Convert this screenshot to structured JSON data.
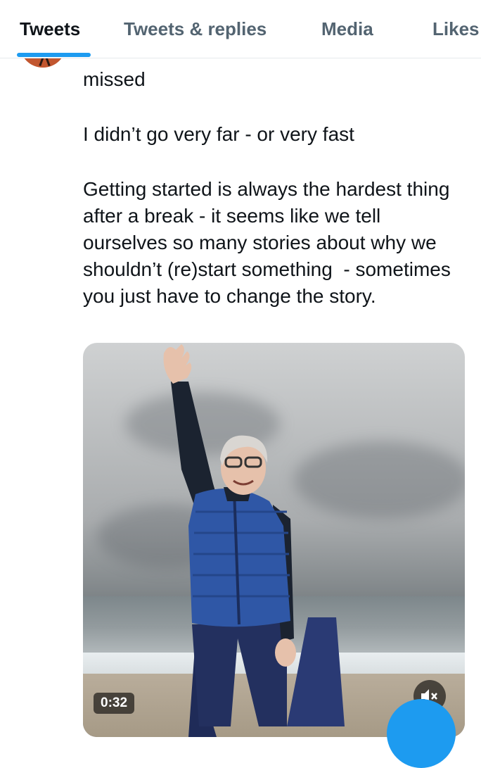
{
  "tabs": [
    {
      "label": "Tweets",
      "active": true
    },
    {
      "label": "Tweets & replies",
      "active": false
    },
    {
      "label": "Media",
      "active": false
    },
    {
      "label": "Likes",
      "active": false
    }
  ],
  "tweet": {
    "paragraphs": [
      "missed",
      "I didn’t go very far - or very fast",
      "Getting started is always the hardest thing after a break - it seems like we tell ourselves so many stories about why we shouldn’t (re)start something  - sometimes you just have to change the story."
    ],
    "video": {
      "duration": "0:32",
      "muted": true
    }
  },
  "colors": {
    "accent": "#1d9bf0",
    "text_primary": "#0f1419",
    "text_secondary": "#536471"
  },
  "icons": {
    "mute": "speaker-muted-icon",
    "compose": "compose-fab"
  }
}
